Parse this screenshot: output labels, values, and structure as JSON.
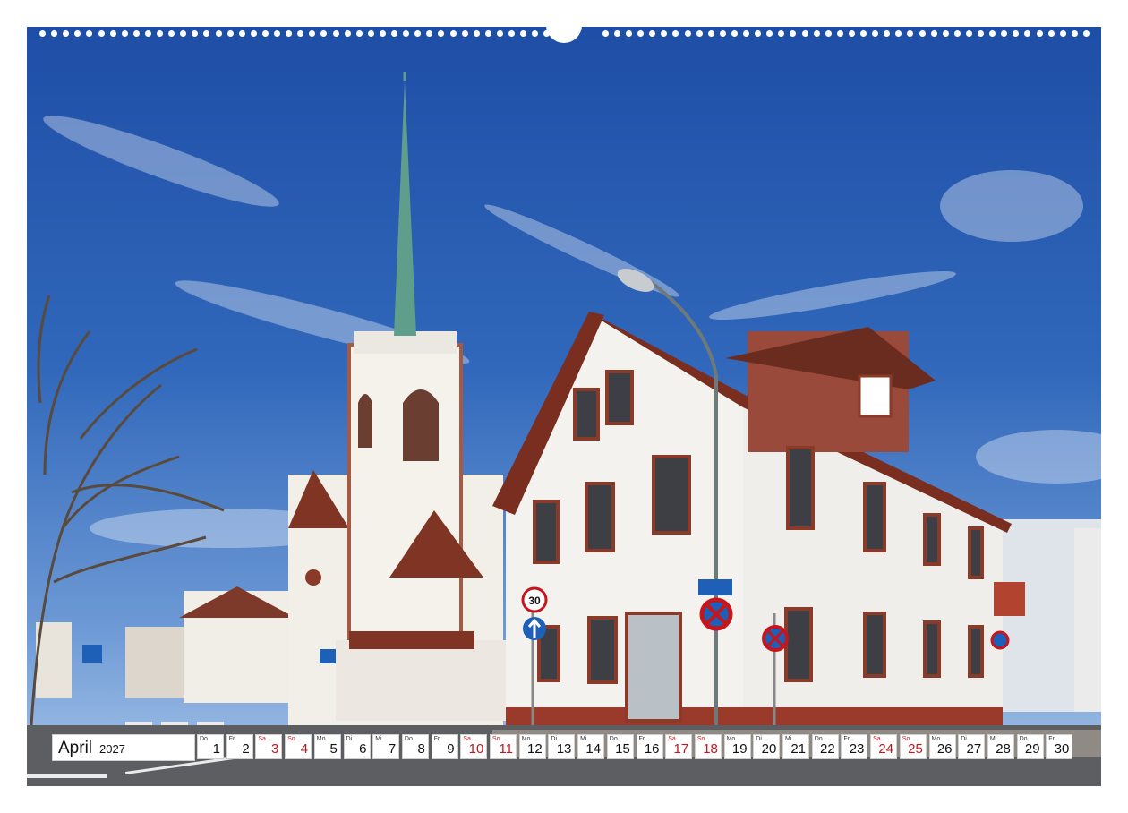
{
  "photo": {
    "scene": "church-tower-and-corner-house-street",
    "colors": {
      "sky": "#2c62b8",
      "spire": "#5e9e8a",
      "roof": "#8a3a26",
      "wall": "#f4f2ee",
      "trim": "#9a4a3a"
    },
    "signs": {
      "speed_limit": "30"
    }
  },
  "calendar": {
    "month": "April",
    "year": "2027",
    "holiday_color": "#c4161c",
    "days": [
      {
        "wd": "Do",
        "num": "1",
        "red": false
      },
      {
        "wd": "Fr",
        "num": "2",
        "red": false
      },
      {
        "wd": "Sa",
        "num": "3",
        "red": true
      },
      {
        "wd": "So",
        "num": "4",
        "red": true
      },
      {
        "wd": "Mo",
        "num": "5",
        "red": false
      },
      {
        "wd": "Di",
        "num": "6",
        "red": false
      },
      {
        "wd": "Mi",
        "num": "7",
        "red": false
      },
      {
        "wd": "Do",
        "num": "8",
        "red": false
      },
      {
        "wd": "Fr",
        "num": "9",
        "red": false
      },
      {
        "wd": "Sa",
        "num": "10",
        "red": true
      },
      {
        "wd": "So",
        "num": "11",
        "red": true
      },
      {
        "wd": "Mo",
        "num": "12",
        "red": false
      },
      {
        "wd": "Di",
        "num": "13",
        "red": false
      },
      {
        "wd": "Mi",
        "num": "14",
        "red": false
      },
      {
        "wd": "Do",
        "num": "15",
        "red": false
      },
      {
        "wd": "Fr",
        "num": "16",
        "red": false
      },
      {
        "wd": "Sa",
        "num": "17",
        "red": true
      },
      {
        "wd": "So",
        "num": "18",
        "red": true
      },
      {
        "wd": "Mo",
        "num": "19",
        "red": false
      },
      {
        "wd": "Di",
        "num": "20",
        "red": false
      },
      {
        "wd": "Mi",
        "num": "21",
        "red": false
      },
      {
        "wd": "Do",
        "num": "22",
        "red": false
      },
      {
        "wd": "Fr",
        "num": "23",
        "red": false
      },
      {
        "wd": "Sa",
        "num": "24",
        "red": true
      },
      {
        "wd": "So",
        "num": "25",
        "red": true
      },
      {
        "wd": "Mo",
        "num": "26",
        "red": false
      },
      {
        "wd": "Di",
        "num": "27",
        "red": false
      },
      {
        "wd": "Mi",
        "num": "28",
        "red": false
      },
      {
        "wd": "Do",
        "num": "29",
        "red": false
      },
      {
        "wd": "Fr",
        "num": "30",
        "red": false
      }
    ]
  }
}
